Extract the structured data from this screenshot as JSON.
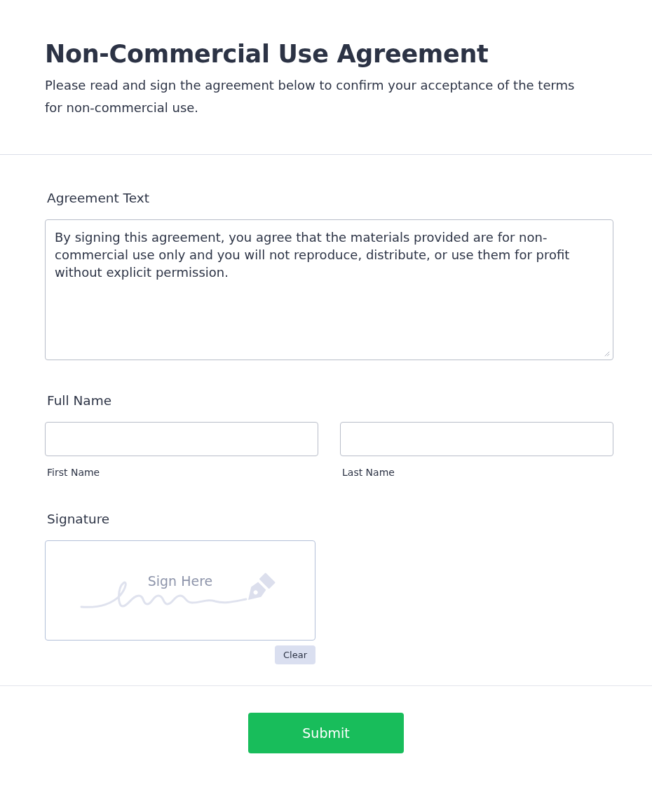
{
  "header": {
    "title": "Non-Commercial Use Agreement",
    "subtitle": "Please read and sign the agreement below to confirm your acceptance of the terms for non-commercial use."
  },
  "fields": [
    {
      "kind": "textarea",
      "label": "Agreement Text",
      "value": "By signing this agreement, you agree that the materials provided are for non-commercial use only and you will not reproduce, distribute, or use them for profit without explicit permission."
    },
    {
      "kind": "fullname",
      "label": "Full Name",
      "parts": [
        {
          "sublabel": "First Name"
        },
        {
          "sublabel": "Last Name"
        }
      ]
    },
    {
      "kind": "signature",
      "label": "Signature",
      "placeholder": "Sign Here",
      "clear_button": "Clear"
    }
  ],
  "submit_button": "Submit"
}
